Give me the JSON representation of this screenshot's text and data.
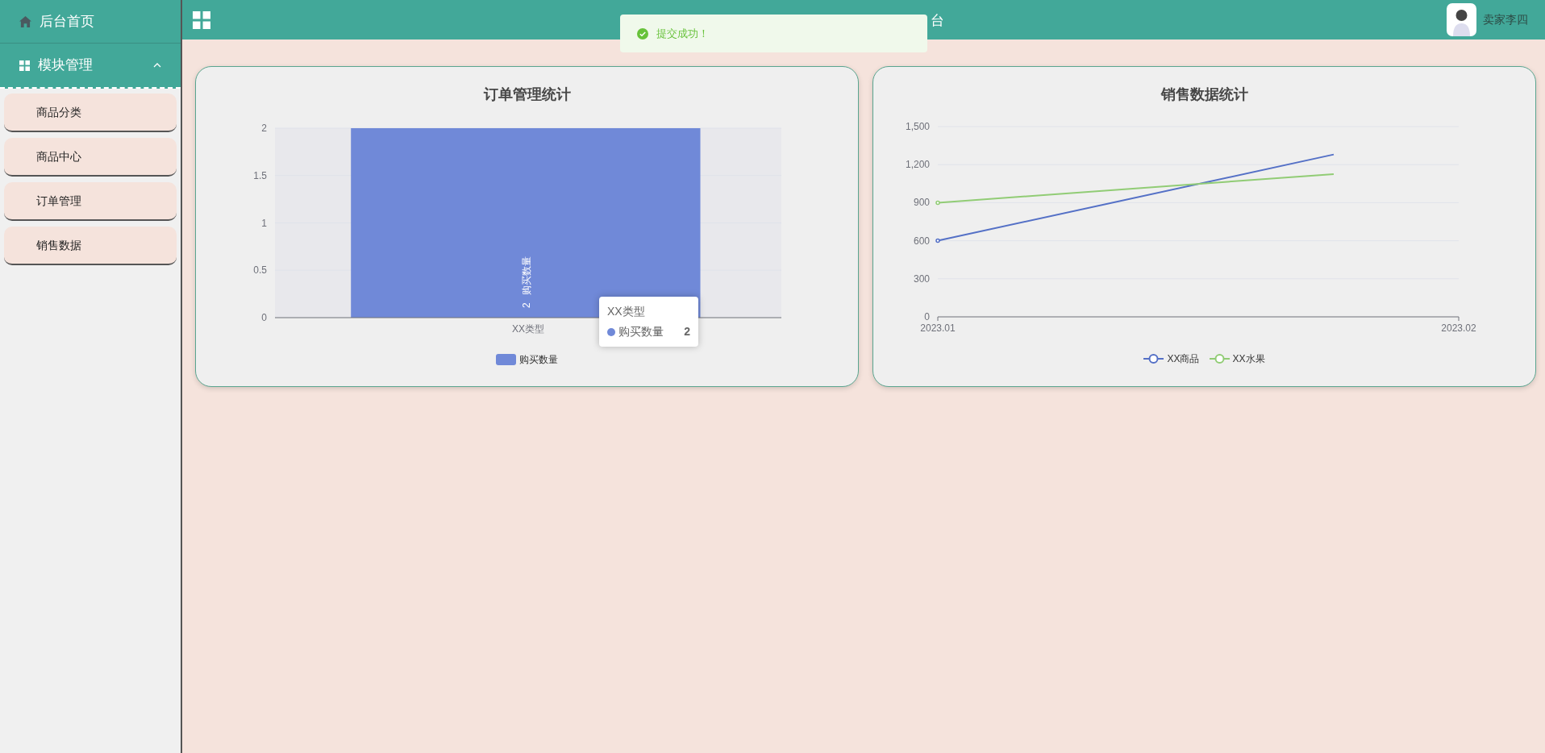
{
  "sidebar": {
    "home": {
      "label": "后台首页"
    },
    "group": {
      "label": "模块管理",
      "expanded": true,
      "children": [
        {
          "label": "商品分类"
        },
        {
          "label": "商品中心"
        },
        {
          "label": "订单管理"
        },
        {
          "label": "销售数据"
        }
      ]
    }
  },
  "header": {
    "title": "台",
    "user": "卖家李四"
  },
  "toast": {
    "message": "提交成功！"
  },
  "charts": [
    {
      "title": "订单管理统计",
      "chart_data": {
        "type": "bar",
        "categories": [
          "XX类型"
        ],
        "ylim": [
          0,
          2
        ],
        "yticks": [
          0,
          0.5,
          1,
          1.5,
          2
        ],
        "grid": true,
        "data_labels": true,
        "series": [
          {
            "name": "购买数量",
            "color": "#7089d8",
            "values": [
              2
            ]
          }
        ]
      },
      "tooltip": {
        "title": "XX类型",
        "series": "购买数量",
        "value": "2"
      }
    },
    {
      "title": "销售数据统计",
      "chart_data": {
        "type": "line",
        "grid": true,
        "x": [
          2023.01,
          2023.0176
        ],
        "xlim": [
          2023.01,
          2023.02
        ],
        "xticks": [
          2023.01,
          2023.02
        ],
        "ylim": [
          0,
          1500
        ],
        "yticks": [
          {
            "value": 0,
            "label": "0"
          },
          {
            "value": 300,
            "label": "300"
          },
          {
            "value": 600,
            "label": "600"
          },
          {
            "value": 900,
            "label": "900"
          },
          {
            "value": 1200,
            "label": "1,200"
          },
          {
            "value": 1500,
            "label": "1,500"
          }
        ],
        "series": [
          {
            "name": "XX商品",
            "color": "#5470c6",
            "values": [
              600,
              1280
            ]
          },
          {
            "name": "XX水果",
            "color": "#91cc75",
            "values": [
              900,
              1125
            ]
          }
        ]
      }
    }
  ]
}
